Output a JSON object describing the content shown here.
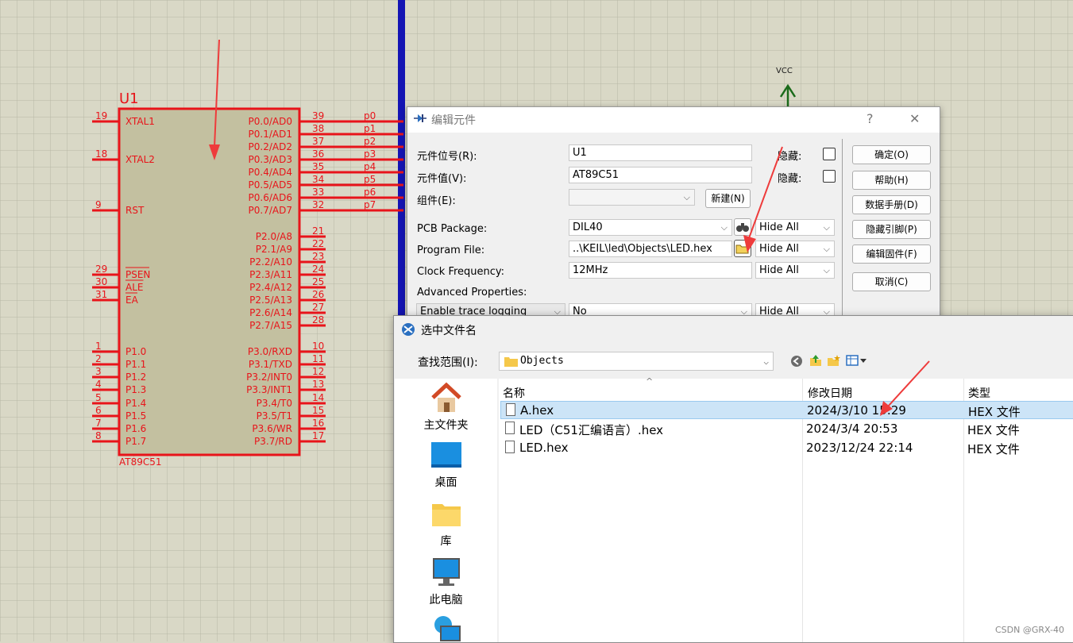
{
  "schematic": {
    "ref": "U1",
    "part": "AT89C51",
    "power_label": "VCC",
    "left_pins": [
      {
        "num": "19",
        "name": "XTAL1"
      },
      {
        "num": "18",
        "name": "XTAL2"
      },
      {
        "num": "9",
        "name": "RST"
      },
      {
        "num": "29",
        "name": "PSEN"
      },
      {
        "num": "30",
        "name": "ALE"
      },
      {
        "num": "31",
        "name": "EA"
      },
      {
        "num": "1",
        "name": "P1.0"
      },
      {
        "num": "2",
        "name": "P1.1"
      },
      {
        "num": "3",
        "name": "P1.2"
      },
      {
        "num": "4",
        "name": "P1.3"
      },
      {
        "num": "5",
        "name": "P1.4"
      },
      {
        "num": "6",
        "name": "P1.5"
      },
      {
        "num": "7",
        "name": "P1.6"
      },
      {
        "num": "8",
        "name": "P1.7"
      }
    ],
    "right_pins": [
      {
        "num": "39",
        "name": "P0.0/AD0",
        "net": "p0"
      },
      {
        "num": "38",
        "name": "P0.1/AD1",
        "net": "p1"
      },
      {
        "num": "37",
        "name": "P0.2/AD2",
        "net": "p2"
      },
      {
        "num": "36",
        "name": "P0.3/AD3",
        "net": "p3"
      },
      {
        "num": "35",
        "name": "P0.4/AD4",
        "net": "p4"
      },
      {
        "num": "34",
        "name": "P0.5/AD5",
        "net": "p5"
      },
      {
        "num": "33",
        "name": "P0.6/AD6",
        "net": "p6"
      },
      {
        "num": "32",
        "name": "P0.7/AD7",
        "net": "p7"
      },
      {
        "num": "21",
        "name": "P2.0/A8",
        "net": ""
      },
      {
        "num": "22",
        "name": "P2.1/A9",
        "net": ""
      },
      {
        "num": "23",
        "name": "P2.2/A10",
        "net": ""
      },
      {
        "num": "24",
        "name": "P2.3/A11",
        "net": ""
      },
      {
        "num": "25",
        "name": "P2.4/A12",
        "net": ""
      },
      {
        "num": "26",
        "name": "P2.5/A13",
        "net": ""
      },
      {
        "num": "27",
        "name": "P2.6/A14",
        "net": ""
      },
      {
        "num": "28",
        "name": "P2.7/A15",
        "net": ""
      },
      {
        "num": "10",
        "name": "P3.0/RXD",
        "net": ""
      },
      {
        "num": "11",
        "name": "P3.1/TXD",
        "net": ""
      },
      {
        "num": "12",
        "name": "P3.2/INT0",
        "net": ""
      },
      {
        "num": "13",
        "name": "P3.3/INT1",
        "net": ""
      },
      {
        "num": "14",
        "name": "P3.4/T0",
        "net": ""
      },
      {
        "num": "15",
        "name": "P3.5/T1",
        "net": ""
      },
      {
        "num": "16",
        "name": "P3.6/WR",
        "net": ""
      },
      {
        "num": "17",
        "name": "P3.7/RD",
        "net": ""
      }
    ]
  },
  "edit_dialog": {
    "title": "编辑元件",
    "help_glyph": "?",
    "close_glyph": "✕",
    "ref_label": "元件位号(R):",
    "ref_value": "U1",
    "value_label": "元件值(V):",
    "value_value": "AT89C51",
    "group_label": "组件(E):",
    "hide_label": "隐藏:",
    "new_button": "新建(N)",
    "pcb_label": "PCB Package:",
    "pcb_value": "DIL40",
    "program_label": "Program File:",
    "program_value": "..\\KEIL\\led\\Objects\\LED.hex",
    "clock_label": "Clock Frequency:",
    "clock_value": "12MHz",
    "advanced_label": "Advanced Properties:",
    "advanced_prop": "Enable trace logging",
    "advanced_value": "No",
    "hide_all": "Hide All",
    "buttons": [
      "确定(O)",
      "帮助(H)",
      "数据手册(D)",
      "隐藏引脚(P)",
      "编辑固件(F)",
      "取消(C)"
    ]
  },
  "file_dialog": {
    "title": "选中文件名",
    "lookin_label": "查找范围(I):",
    "lookin_value": "Objects",
    "places": [
      "主文件夹",
      "桌面",
      "库",
      "此电脑"
    ],
    "columns": [
      "名称",
      "修改日期",
      "类型"
    ],
    "files": [
      {
        "name": "A.hex",
        "date": "2024/3/10 15:29",
        "type": "HEX 文件",
        "selected": true
      },
      {
        "name": "LED（C51汇编语言）.hex",
        "date": "2024/3/4 20:53",
        "type": "HEX 文件",
        "selected": false
      },
      {
        "name": "LED.hex",
        "date": "2023/12/24 22:14",
        "type": "HEX 文件",
        "selected": false
      }
    ]
  },
  "watermark": "CSDN @GRX-40",
  "colors": {
    "pin": "#e8141a",
    "body": "#c3c0a0",
    "grid": "#b8b7a5",
    "bus": "#1414b4",
    "power": "#1a6b1a",
    "annotation": "#ee3b3b"
  }
}
